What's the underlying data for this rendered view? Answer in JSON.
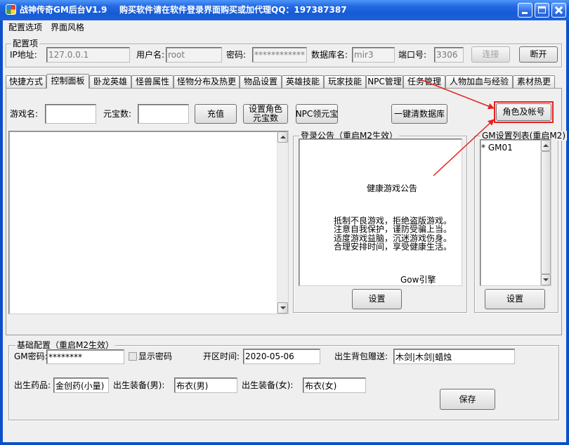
{
  "window": {
    "title": "战神传奇GM后台V1.9",
    "notice": "购买软件请在软件登录界面购买或加代理QQ：197387387",
    "icons": {
      "app": "app-icon",
      "minimize": "minimize-icon",
      "maximize": "maximize-icon",
      "close": "close-icon"
    }
  },
  "menu": {
    "items": [
      {
        "label": "配置选项"
      },
      {
        "label": "界面风格"
      }
    ]
  },
  "config": {
    "legend": "配置项",
    "ip": {
      "label": "IP地址:",
      "value": "127.0.0.1"
    },
    "user": {
      "label": "用户名:",
      "value": "root"
    },
    "password": {
      "label": "密码:",
      "value": "************"
    },
    "database": {
      "label": "数据库名:",
      "value": "mir3"
    },
    "port": {
      "label": "端口号:",
      "value": "3306"
    },
    "connect": {
      "label": "连接",
      "enabled": false
    },
    "disconnect": {
      "label": "断开",
      "enabled": true
    }
  },
  "tabs": [
    {
      "label": "快捷方式",
      "selected": false
    },
    {
      "label": "控制面板",
      "selected": true
    },
    {
      "label": "卧龙英雄",
      "selected": false
    },
    {
      "label": "怪兽属性",
      "selected": false
    },
    {
      "label": "怪物分布及热更",
      "selected": false
    },
    {
      "label": "物品设置",
      "selected": false
    },
    {
      "label": "英雄技能",
      "selected": false
    },
    {
      "label": "玩家技能",
      "selected": false
    },
    {
      "label": "NPC管理",
      "selected": false
    },
    {
      "label": "任务管理",
      "selected": false
    },
    {
      "label": "人物加血与经验",
      "selected": false
    },
    {
      "label": "素材热更",
      "selected": false
    }
  ],
  "control_panel": {
    "game_name_label": "游戏名:",
    "yuanbao_label": "元宝数:",
    "buttons": {
      "recharge": "充值",
      "set_role_yuanbao": "设置角色元宝数",
      "npc_yuanbao": "NPC领元宝",
      "clear_database": "一键清数据库",
      "role_account": "角色及帐号"
    },
    "announcement": {
      "legend": "登录公告（重启M2生效）",
      "heading": "健康游戏公告",
      "lines": [
        "抵制不良游戏，拒绝盗版游戏。",
        "注意自我保护，谨防受骗上当。",
        "适度游戏益脑，沉迷游戏伤身。",
        "合理安排时间，享受健康生活。"
      ],
      "footer": "Gow引擎",
      "set_label": "设置"
    },
    "gm_list": {
      "legend": "GM设置列表(重启M2)",
      "items": [
        "* GM01"
      ],
      "set_label": "设置"
    }
  },
  "basic_config": {
    "legend": "基础配置（重启M2生效）",
    "gm_password": {
      "label": "GM密码:",
      "value": "********"
    },
    "show_password": {
      "label": "显示密码",
      "checked": false
    },
    "open_time": {
      "label": "开区时间:",
      "value": "2020-05-06"
    },
    "birth_bag": {
      "label": "出生背包赠送:",
      "value": "木剑|木剑|蜡烛"
    },
    "birth_potion": {
      "label": "出生药品:",
      "value": "金创药(小量)"
    },
    "birth_equip_male": {
      "label": "出生装备(男):",
      "value": "布衣(男)"
    },
    "birth_equip_female": {
      "label": "出生装备(女):",
      "value": "布衣(女)"
    },
    "save_label": "保存"
  },
  "colors": {
    "title_bar": "#1A5FD8",
    "window_frame": "#0B4FCB",
    "annotation": "#E8201E",
    "window_background": "#EFEFEF"
  }
}
